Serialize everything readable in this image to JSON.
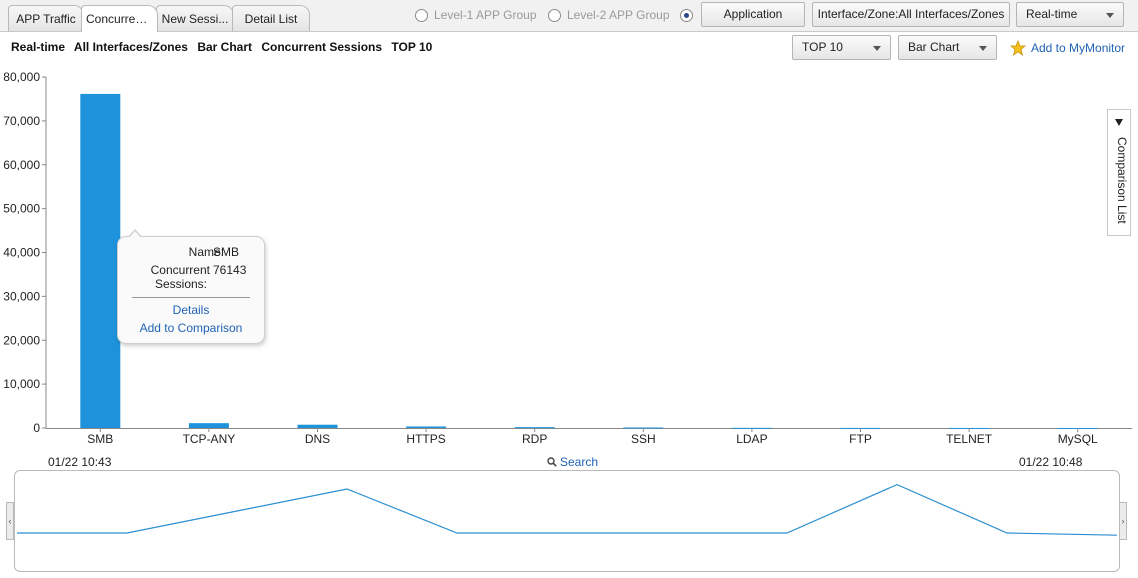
{
  "tabs": [
    {
      "label": "APP Traffic",
      "active": false
    },
    {
      "label": "Concurrent...",
      "active": true
    },
    {
      "label": "New Sessi...",
      "active": false
    },
    {
      "label": "Detail List",
      "active": false
    }
  ],
  "radio_options": [
    {
      "label": "Level-1 APP Group",
      "checked": false
    },
    {
      "label": "Level-2 APP Group",
      "checked": false
    },
    {
      "label": "",
      "checked": true
    }
  ],
  "toolbar": {
    "application_button": "Application",
    "interface_button": "Interface/Zone:All Interfaces/Zones",
    "time_select": "Real-time"
  },
  "subtitle": {
    "mode": "Real-time",
    "scope": "All Interfaces/Zones",
    "chart_type": "Bar Chart",
    "metric": "Concurrent Sessions",
    "top": "TOP 10"
  },
  "controls": {
    "top_select": "TOP 10",
    "chart_select": "Bar Chart",
    "add_mymonitor": "Add to MyMonitor"
  },
  "colors": {
    "bar": "#1e93dc",
    "line": "#2a8fd0",
    "link": "#1f63b6"
  },
  "chart_data": {
    "type": "bar",
    "categories": [
      "SMB",
      "TCP-ANY",
      "DNS",
      "HTTPS",
      "RDP",
      "SSH",
      "LDAP",
      "FTP",
      "TELNET",
      "MySQL"
    ],
    "values": [
      76143,
      1100,
      750,
      350,
      200,
      120,
      40,
      20,
      10,
      5
    ],
    "y_ticks": [
      "80,000",
      "70,000",
      "60,000",
      "50,000",
      "40,000",
      "30,000",
      "20,000",
      "10,000",
      "0"
    ],
    "ylim": [
      0,
      80000
    ],
    "xlabel": "",
    "ylabel": ""
  },
  "tooltip": {
    "name_label": "Name:",
    "name_value": "SMB",
    "sessions_label_1": "Concurrent",
    "sessions_label_2": "Sessions:",
    "sessions_value": "76143",
    "details_link": "Details",
    "compare_link": "Add to Comparison"
  },
  "comparison_tab": {
    "label": "Comparison List"
  },
  "timeline": {
    "start": "01/22 10:43",
    "end": "01/22 10:48",
    "search_label": "Search",
    "overview_values": [
      0,
      0,
      0.5,
      1,
      0,
      0,
      0,
      0,
      1.1,
      0,
      -0.05
    ]
  }
}
